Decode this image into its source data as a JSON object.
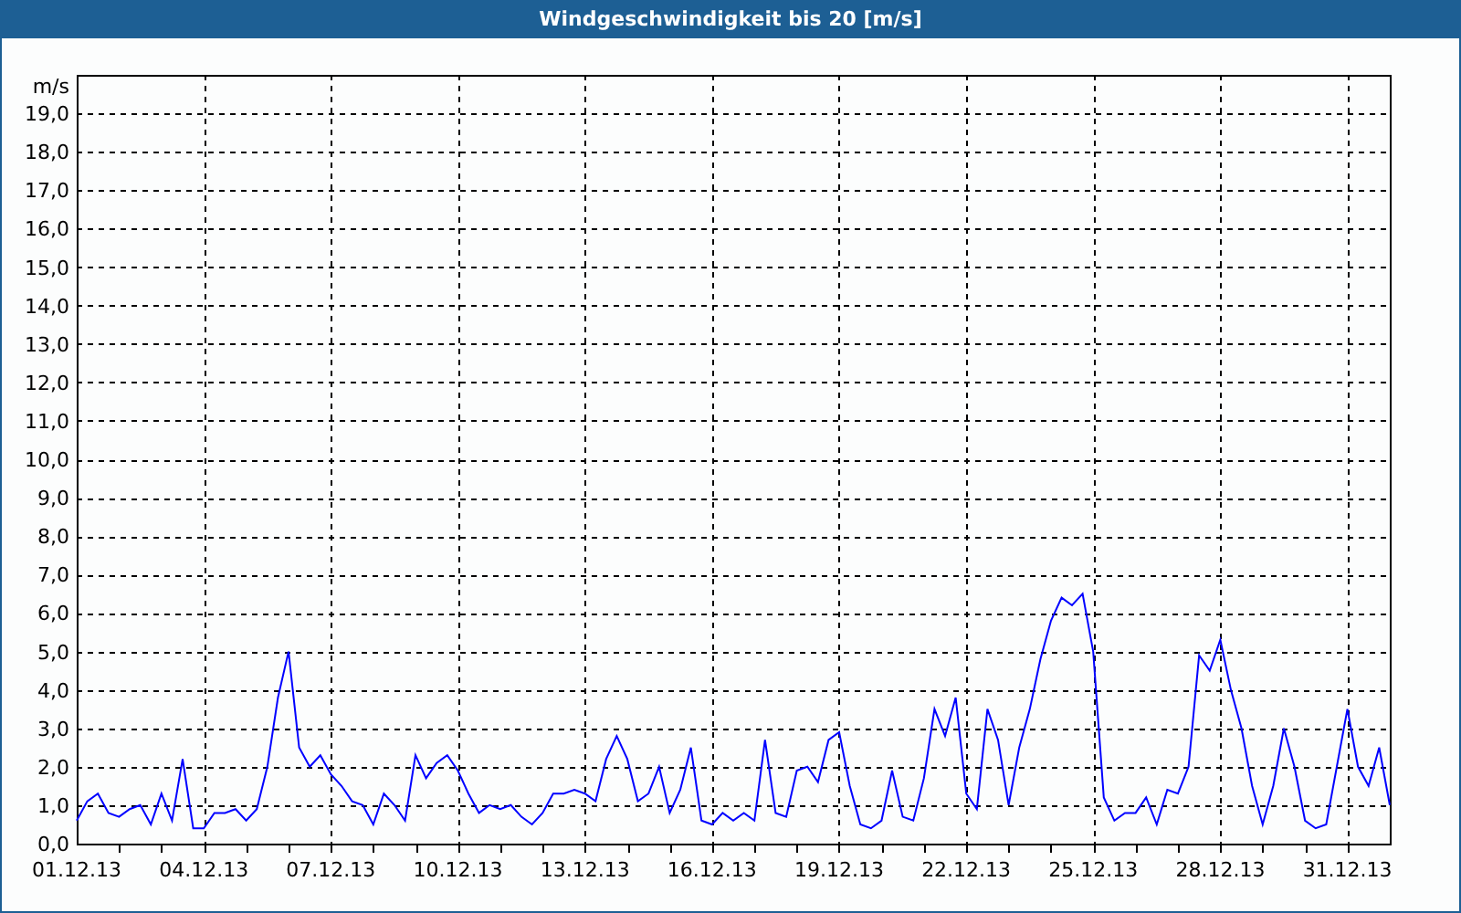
{
  "window": {
    "title": "Windgeschwindigkeit bis 20 [m/s]"
  },
  "chart": {
    "chart_data": {
      "type": "line",
      "ylabel": "m/s",
      "grid": true,
      "ylim": [
        0,
        20
      ],
      "categories": [
        "01.12.13",
        null,
        null,
        null,
        null,
        null,
        null,
        null,
        null,
        null,
        null,
        null,
        "04.12.13",
        null,
        null,
        null,
        null,
        null,
        null,
        null,
        null,
        null,
        null,
        null,
        "07.12.13",
        null,
        null,
        null,
        null,
        null,
        null,
        null,
        null,
        null,
        null,
        null,
        "10.12.13",
        null,
        null,
        null,
        null,
        null,
        null,
        null,
        null,
        null,
        null,
        null,
        "13.12.13",
        null,
        null,
        null,
        null,
        null,
        null,
        null,
        null,
        null,
        null,
        null,
        "16.12.13",
        null,
        null,
        null,
        null,
        null,
        null,
        null,
        null,
        null,
        null,
        null,
        "19.12.13",
        null,
        null,
        null,
        null,
        null,
        null,
        null,
        null,
        null,
        null,
        null,
        "22.12.13",
        null,
        null,
        null,
        null,
        null,
        null,
        null,
        null,
        null,
        null,
        null,
        "25.12.13",
        null,
        null,
        null,
        null,
        null,
        null,
        null,
        null,
        null,
        null,
        null,
        "28.12.13",
        null,
        null,
        null,
        null,
        null,
        null,
        null,
        null,
        null,
        null,
        null,
        "31.12.13",
        null,
        null,
        null,
        null
      ],
      "yticks": [
        {
          "value": 0,
          "label": "0,0"
        },
        {
          "value": 1,
          "label": "1,0"
        },
        {
          "value": 2,
          "label": "2,0"
        },
        {
          "value": 3,
          "label": "3,0"
        },
        {
          "value": 4,
          "label": "4,0"
        },
        {
          "value": 5,
          "label": "5,0"
        },
        {
          "value": 6,
          "label": "6,0"
        },
        {
          "value": 7,
          "label": "7,0"
        },
        {
          "value": 8,
          "label": "8,0"
        },
        {
          "value": 9,
          "label": "9,0"
        },
        {
          "value": 10,
          "label": "10,0"
        },
        {
          "value": 11,
          "label": "11,0"
        },
        {
          "value": 12,
          "label": "12,0"
        },
        {
          "value": 13,
          "label": "13,0"
        },
        {
          "value": 14,
          "label": "14,0"
        },
        {
          "value": 15,
          "label": "15,0"
        },
        {
          "value": 16,
          "label": "16,0"
        },
        {
          "value": 17,
          "label": "17,0"
        },
        {
          "value": 18,
          "label": "18,0"
        },
        {
          "value": 19,
          "label": "19,0"
        }
      ],
      "series": [
        {
          "color": "#0000ff",
          "values": [
            0.6,
            1.1,
            1.3,
            0.8,
            0.7,
            0.9,
            1.0,
            0.5,
            1.3,
            0.6,
            2.2,
            0.4,
            0.4,
            0.8,
            0.8,
            0.9,
            0.6,
            0.9,
            2.0,
            3.8,
            5.0,
            2.5,
            2.0,
            2.3,
            1.8,
            1.5,
            1.1,
            1.0,
            0.5,
            1.3,
            1.0,
            0.6,
            2.3,
            1.7,
            2.1,
            2.3,
            1.9,
            1.3,
            0.8,
            1.0,
            0.9,
            1.0,
            0.7,
            0.5,
            0.8,
            1.3,
            1.3,
            1.4,
            1.3,
            1.1,
            2.2,
            2.8,
            2.2,
            1.1,
            1.3,
            2.0,
            0.8,
            1.4,
            2.5,
            0.6,
            0.5,
            0.8,
            0.6,
            0.8,
            0.6,
            2.7,
            0.8,
            0.7,
            1.9,
            2.0,
            1.6,
            2.7,
            2.9,
            1.5,
            0.5,
            0.4,
            0.6,
            1.9,
            0.7,
            0.6,
            1.7,
            3.5,
            2.8,
            3.8,
            1.3,
            0.9,
            3.5,
            2.7,
            1.0,
            2.5,
            3.5,
            4.8,
            5.8,
            6.4,
            6.2,
            6.5,
            5.0,
            1.2,
            0.6,
            0.8,
            0.8,
            1.2,
            0.5,
            1.4,
            1.3,
            2.0,
            4.9,
            4.5,
            5.3,
            4.0,
            3.0,
            1.5,
            0.5,
            1.5,
            3.0,
            2.0,
            0.6,
            0.4,
            0.5,
            2.0,
            3.5,
            2.0,
            1.5,
            2.5,
            1.0
          ]
        }
      ]
    }
  }
}
